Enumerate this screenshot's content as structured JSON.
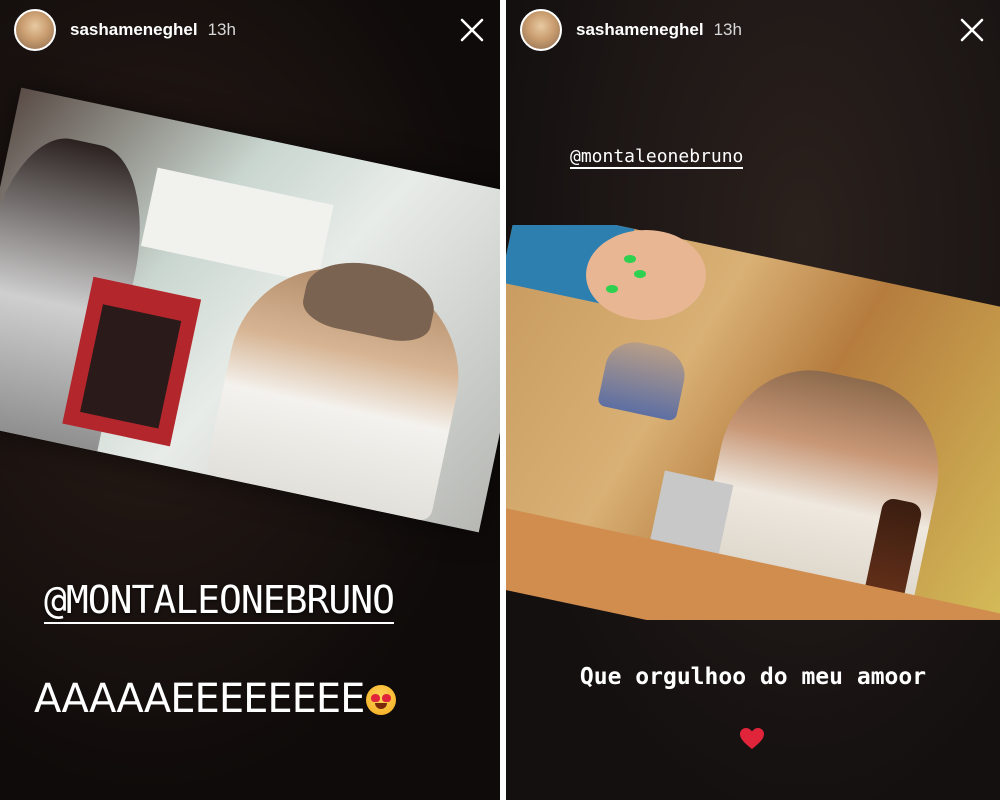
{
  "stories": [
    {
      "username": "sashameneghel",
      "time": "13h",
      "mention_text": "@MONTALEONEBRUNO",
      "shout_text": "AAAAAEEEEEEEE",
      "emoji": "heart-eyes-emoji"
    },
    {
      "username": "sashameneghel",
      "time": "13h",
      "mention_text": "@montaleonebruno",
      "caption": "Que orgulhoo do meu amoor",
      "emoji": "red-heart-emoji"
    }
  ],
  "colors": {
    "text": "#ffffff",
    "heart": "#e0243a",
    "green_nail": "#2ed14f"
  }
}
